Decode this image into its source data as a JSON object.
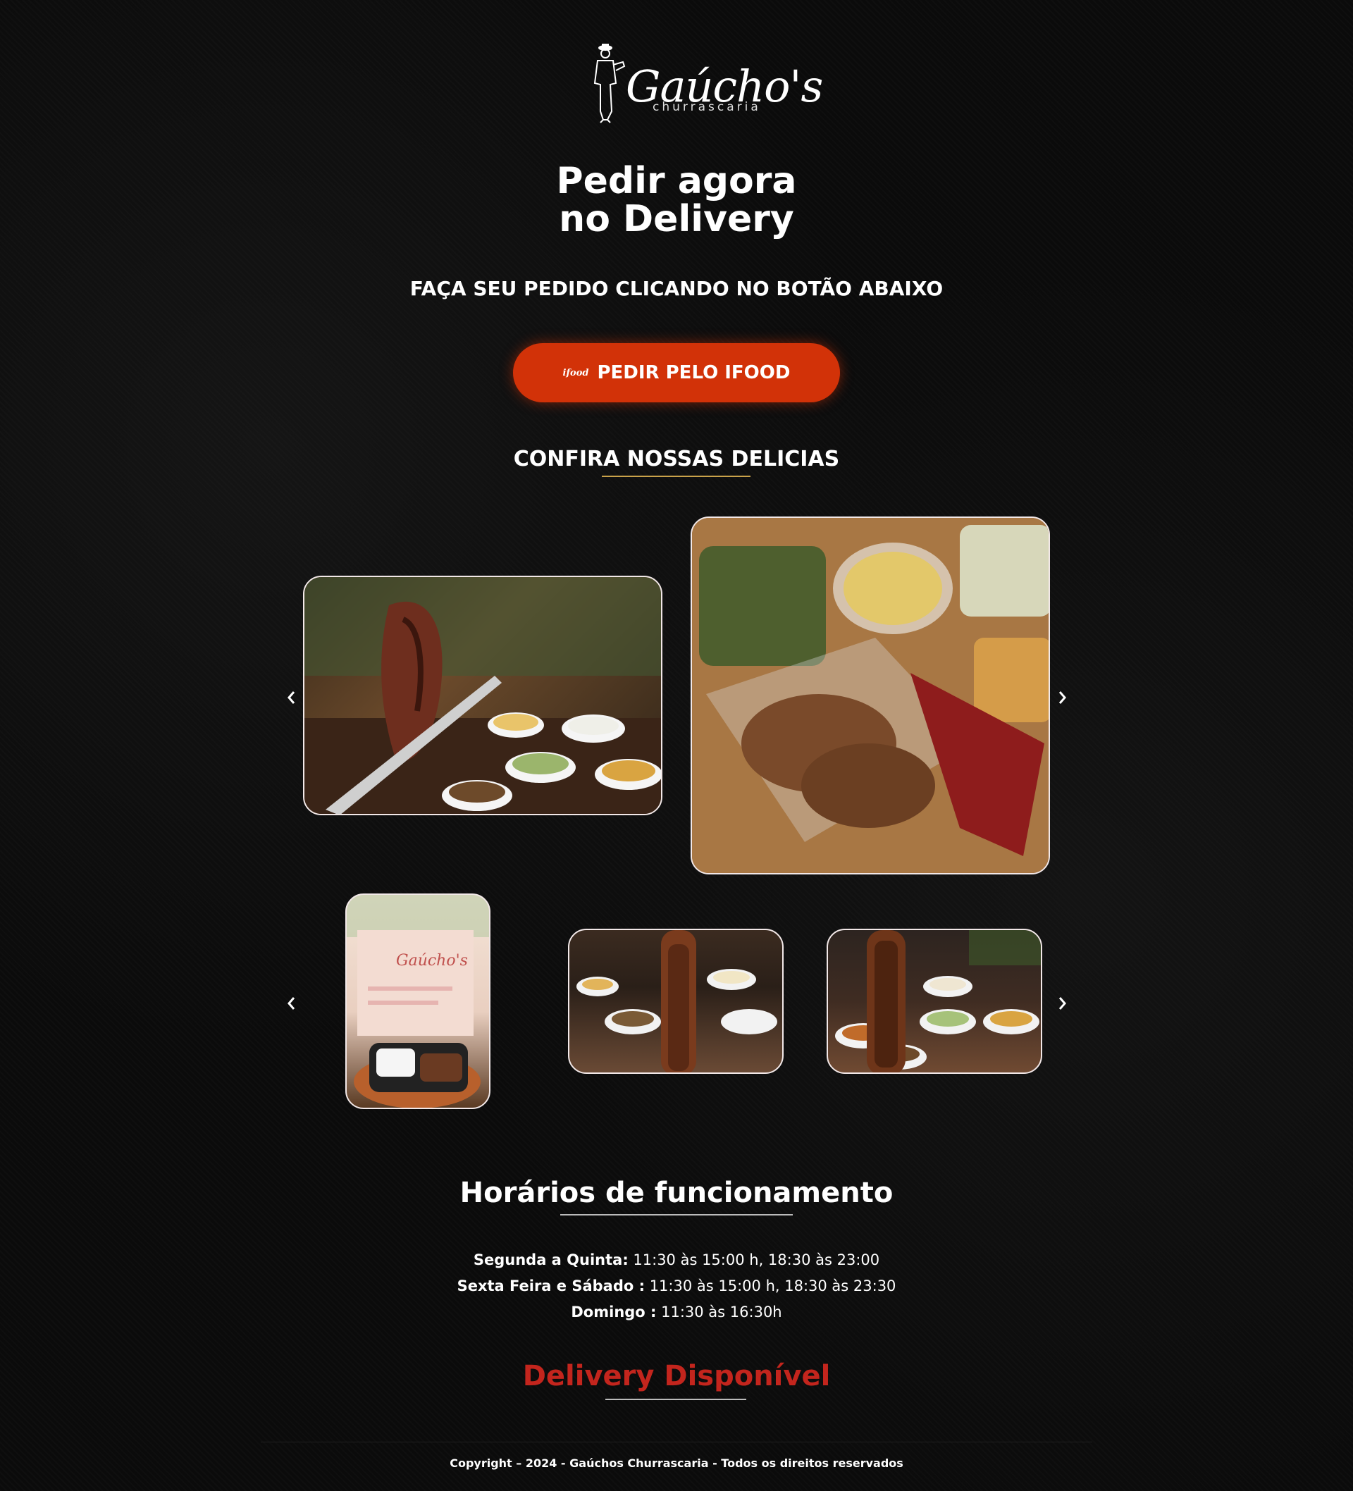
{
  "brand": {
    "name": "Gaúcho's",
    "tagline": "churrascaria"
  },
  "hero": {
    "title_line1": "Pedir agora",
    "title_line2": "no Delivery",
    "subtitle": "FAÇA SEU PEDIDO CLICANDO NO BOTÃO ABAIXO"
  },
  "cta": {
    "icon_text": "ifood",
    "label": "PEDIR PELO IFOOD",
    "color": "#d23208"
  },
  "gallery": {
    "title": "CONFIRA NOSSAS DELICIAS",
    "prev_icon": "chevron-left-icon",
    "next_icon": "chevron-right-icon"
  },
  "hours": {
    "title": "Horários de funcionamento",
    "rows": [
      {
        "day": "Segunda a Quinta:",
        "time": " 11:30 às 15:00 h, 18:30 às 23:00"
      },
      {
        "day": "Sexta Feira e Sábado :",
        "time": " 11:30 às 15:00 h, 18:30 às 23:30"
      },
      {
        "day": "Domingo :",
        "time": " 11:30 às 16:30h"
      }
    ]
  },
  "delivery": {
    "label": "Delivery Disponível",
    "color": "#c3251d"
  },
  "footer": {
    "copyright": "Copyright – 2024 - Gaúchos Churrascaria - Todos os direitos reservados"
  }
}
